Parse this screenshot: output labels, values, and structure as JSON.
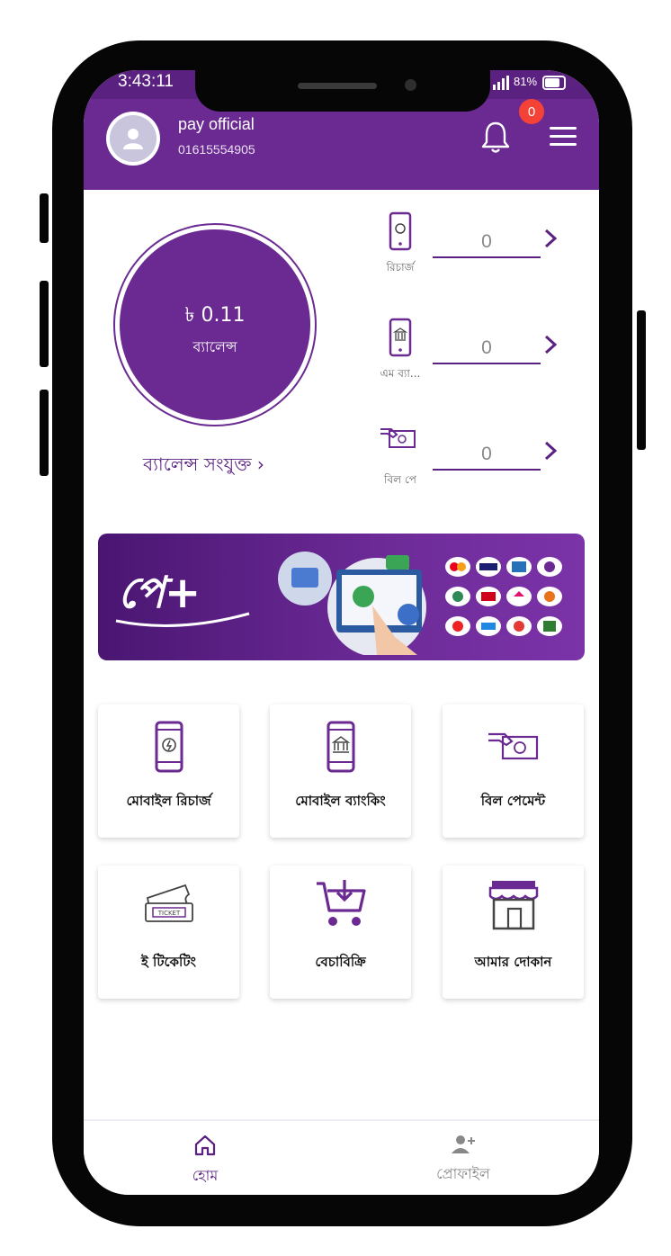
{
  "status_bar": {
    "time": "3:43:11",
    "battery": "81%"
  },
  "header": {
    "user_name": "pay official",
    "user_phone": "01615554905",
    "notification_count": "0"
  },
  "balance": {
    "amount": "৳ 0.11",
    "label": "ব্যালেন্স",
    "add_link": "ব্যালেন্স সংযুক্ত ›"
  },
  "stats": [
    {
      "label": "রিচার্জ",
      "value": "0",
      "icon": "mobile-recharge-icon"
    },
    {
      "label": "এম ব্যা...",
      "value": "0",
      "icon": "mobile-bank-icon"
    },
    {
      "label": "বিল পে",
      "value": "0",
      "icon": "bill-pay-icon"
    }
  ],
  "banner": {
    "brand_text": "পে+"
  },
  "services": [
    {
      "label": "মোবাইল রিচার্জ",
      "icon": "mobile-recharge-icon"
    },
    {
      "label": "মোবাইল ব্যাংকিং",
      "icon": "mobile-banking-icon"
    },
    {
      "label": "বিল পেমেন্ট",
      "icon": "bill-payment-icon"
    },
    {
      "label": "ই টিকেটিং",
      "icon": "ticket-icon"
    },
    {
      "label": "বেচাবিক্রি",
      "icon": "cart-icon"
    },
    {
      "label": "আমার দোকান",
      "icon": "shop-icon"
    }
  ],
  "bottom_nav": [
    {
      "label": "হোম",
      "icon": "home-icon",
      "active": true
    },
    {
      "label": "প্রোফাইল",
      "icon": "add-user-icon",
      "active": false
    }
  ],
  "colors": {
    "primary": "#6a2a92",
    "dark": "#5b2180",
    "badge": "#f44336"
  }
}
